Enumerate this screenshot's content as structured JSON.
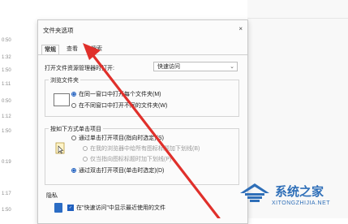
{
  "background": {
    "times": [
      "0:50",
      "1:32",
      "1:50",
      "1:11",
      "0:50",
      "1:12",
      "1:50",
      "0:19",
      "1:17",
      "1:50"
    ]
  },
  "dialog": {
    "title": "文件夹选项",
    "close_glyph": "×",
    "tabs": [
      {
        "label": "常规",
        "active": true
      },
      {
        "label": "查看",
        "active": false
      },
      {
        "label": "搜索",
        "active": false
      }
    ],
    "open_label": "打开文件资源管理器时打开:",
    "open_value": "快速访问",
    "browse_group": {
      "title": "浏览文件夹",
      "options": [
        {
          "label": "在同一窗口中打开每个文件夹(M)",
          "checked": true,
          "disabled": false
        },
        {
          "label": "在不同窗口中打开不同的文件夹(W)",
          "checked": false,
          "disabled": false
        }
      ]
    },
    "click_group": {
      "title": "按如下方式单击项目",
      "options": [
        {
          "label": "通过单击打开项目(指向时选定)(S)",
          "checked": false,
          "disabled": false
        },
        {
          "label": "在我的浏览器中给所有图标标题加下划线(B)",
          "checked": false,
          "disabled": true
        },
        {
          "label": "仅当指向图标标题时加下划线(P)",
          "checked": false,
          "disabled": true
        },
        {
          "label": "通过双击打开项目(单击时选定)(D)",
          "checked": true,
          "disabled": false
        }
      ]
    },
    "privacy_group": {
      "title": "隐私",
      "checkbox_label": "在\"快速访问\"中显示最近使用的文件"
    }
  },
  "watermark": {
    "text": "系统之家",
    "sub": "XITONGZHIJIA.NET"
  },
  "colors": {
    "accent": "#1f5fbf",
    "arrow": "#e0302b",
    "watermark": "#2f6fb8"
  }
}
